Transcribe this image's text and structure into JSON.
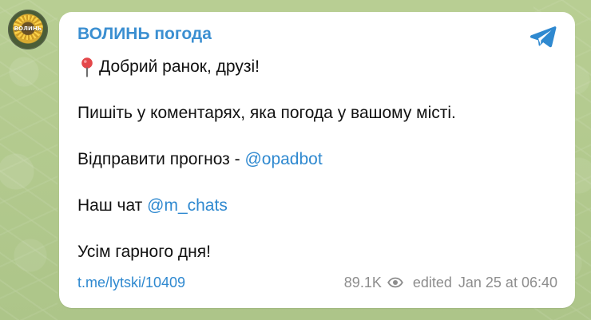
{
  "channel": {
    "name": "ВОЛИНЬ погода",
    "avatar_text": "ВОЛИНЬ"
  },
  "message": {
    "greeting": "Добрий ранок, друзі!",
    "comments_prompt": "Пишіть у коментарях, яка погода у вашому місті.",
    "forecast_prefix": "Відправити прогноз - ",
    "forecast_mention": "@opadbot",
    "chat_prefix": "Наш чат ",
    "chat_mention": "@m_chats",
    "closing": "Усім гарного дня!"
  },
  "footer": {
    "link": "t.me/lytski/10409",
    "views": "89.1K",
    "edited": "edited",
    "datetime": "Jan 25 at 06:40"
  },
  "icons": {
    "pin": "pin-icon",
    "share": "telegram-send-icon",
    "views": "eye-icon"
  },
  "colors": {
    "accent": "#2f89d0",
    "channel": "#3b8fd1",
    "pin": "#e4474a",
    "background": "#b9cf92",
    "bubble": "#ffffff",
    "meta": "#8d8d8d"
  }
}
